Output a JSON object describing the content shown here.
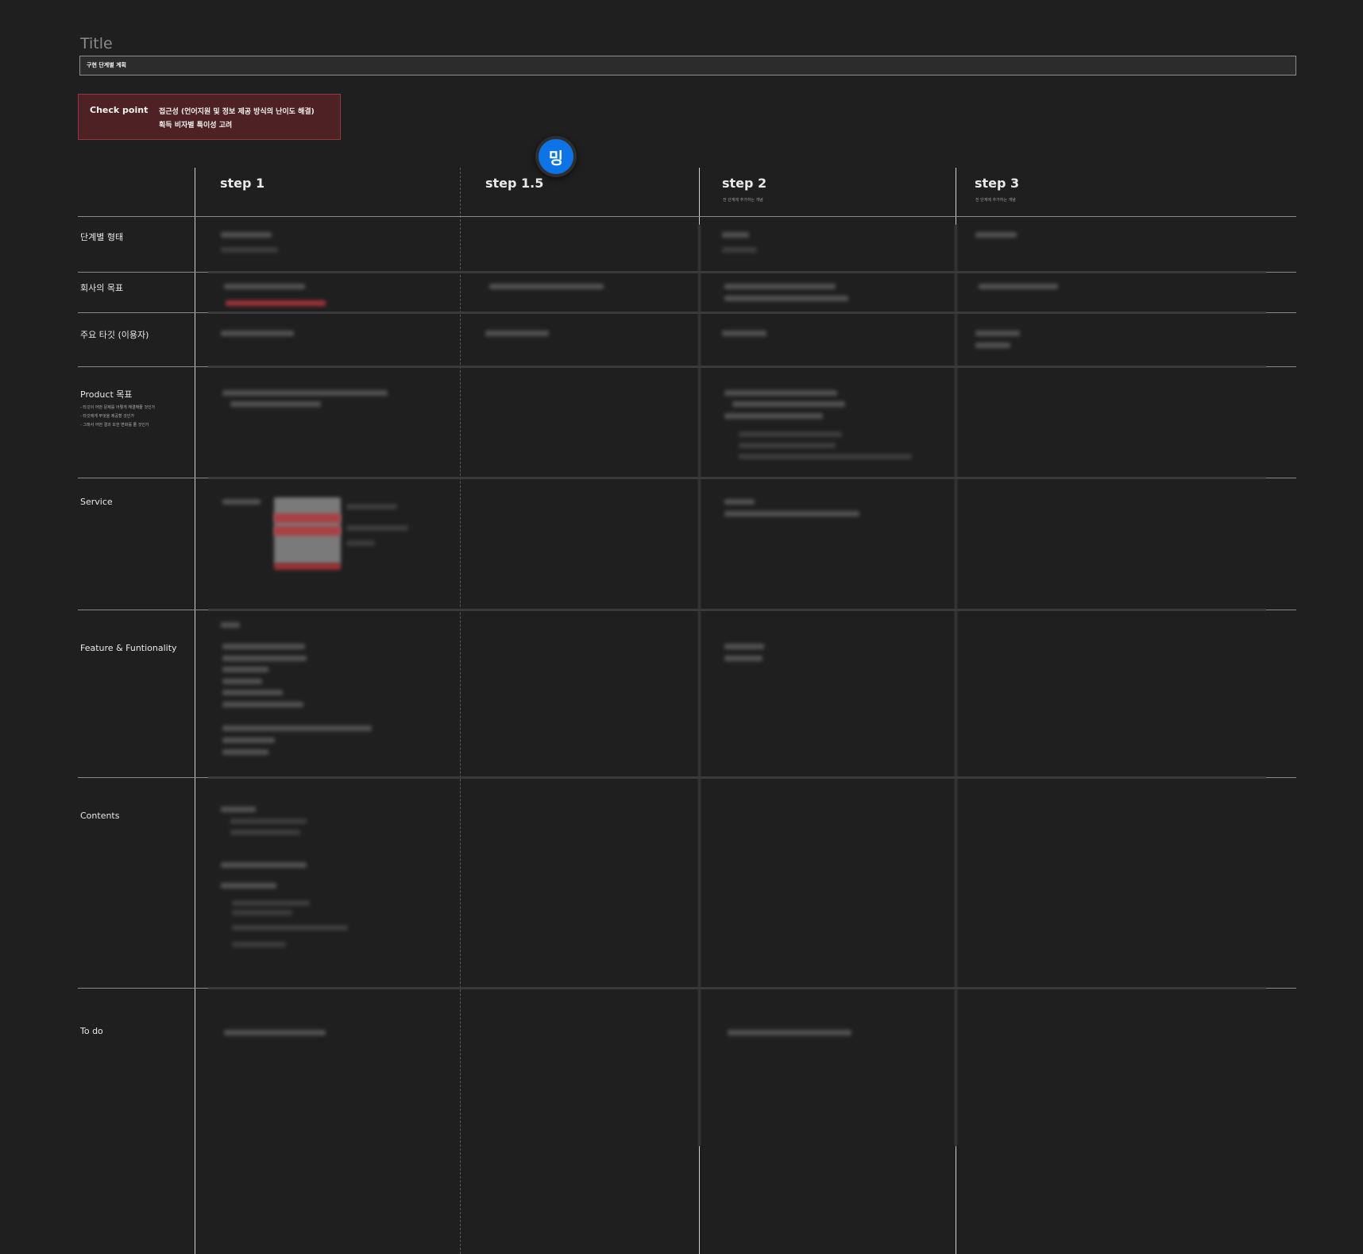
{
  "page": {
    "title": "Title",
    "subtitle": "구현 단계별 계획"
  },
  "checkpoint": {
    "label": "Check point",
    "lines": [
      "접근성 (언어지원 및 정보 제공 방식의 난이도 해결)",
      "획득 비자별 특이성 고려"
    ]
  },
  "avatar": {
    "initial": "밍",
    "color": "#0d74e7"
  },
  "steps": [
    {
      "name": "step 1",
      "note": ""
    },
    {
      "name": "step 1.5",
      "note": ""
    },
    {
      "name": "step 2",
      "note": "전 단계에 추가하는 개념"
    },
    {
      "name": "step 3",
      "note": "전 단계에 추가하는 개념"
    }
  ],
  "rows": [
    {
      "label": "단계별 형태"
    },
    {
      "label": "회사의 목표"
    },
    {
      "label": "주요 타깃 (이용자)"
    },
    {
      "label": "Product 목표",
      "notes": [
        "- 타깃이 어떤 문제를 어떻게 해결해줄 것인가",
        "- 타깃에게 무엇을 제공할 것인가",
        "- 그래서 어떤 결과 또한 변화를 줄 것인가"
      ]
    },
    {
      "label": "Service"
    },
    {
      "label": "Feature & Funtionality"
    },
    {
      "label": "Contents"
    },
    {
      "label": "To do"
    }
  ],
  "colors": {
    "background": "#1f1f1f",
    "checkpoint_bg": "#4e2224",
    "accent_red": "#b2373a",
    "avatar_blue": "#0d74e7"
  }
}
